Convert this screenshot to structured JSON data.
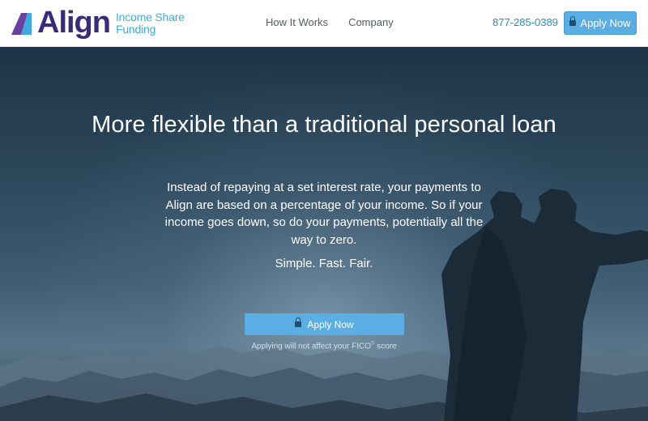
{
  "header": {
    "logo_word": "Align",
    "logo_sub_line1": "Income Share",
    "logo_sub_line2": "Funding",
    "nav": [
      "How It Works",
      "Company"
    ],
    "phone": "877-285-0389",
    "apply_label": "Apply Now"
  },
  "hero": {
    "title": "More flexible than a traditional personal loan",
    "body": "Instead of repaying at a set interest rate, your payments to Align are based on a percentage of your income. So if your income goes down, so do your payments, potentially all the way to zero.",
    "tagline": "Simple. Fast. Fair.",
    "apply_label": "Apply Now",
    "disclaimer_pre": "Applying will not affect your FICO",
    "disclaimer_sup": "©",
    "disclaimer_post": " score"
  },
  "colors": {
    "brand_purple": "#3b2a78",
    "brand_blue": "#3fa9e0",
    "button_blue": "#5aaee3"
  },
  "icons": [
    "align-logo-icon",
    "lock-icon"
  ]
}
